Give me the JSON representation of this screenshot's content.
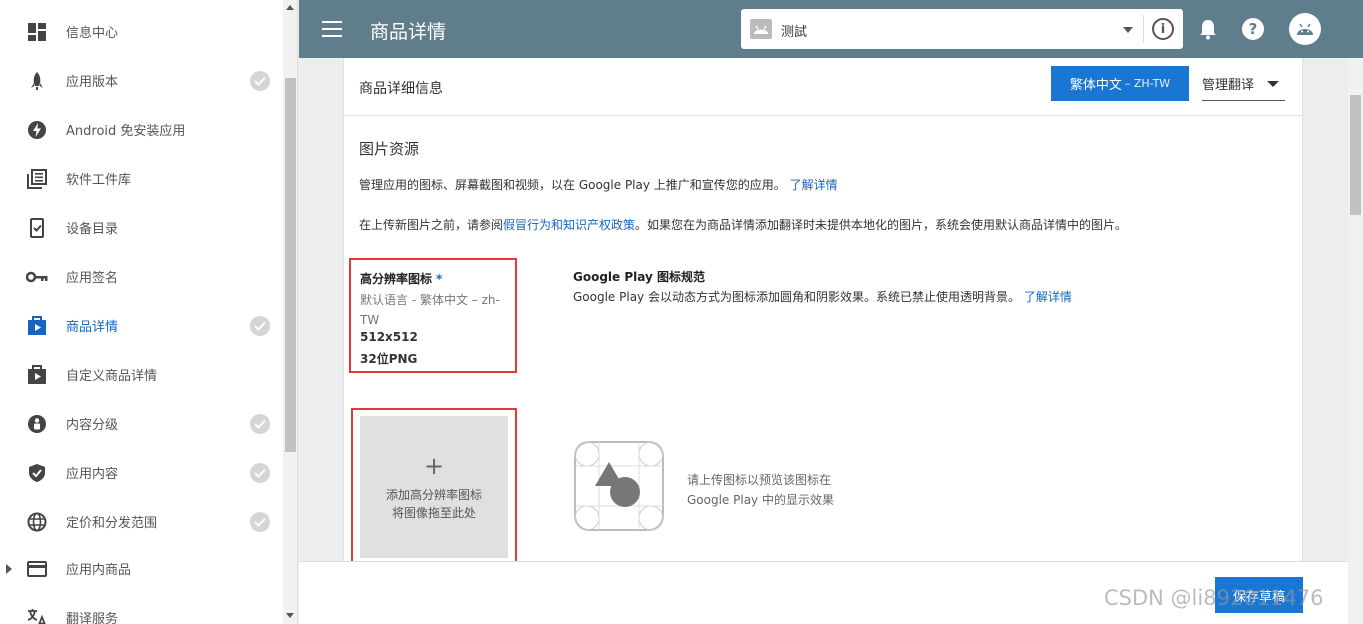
{
  "sidebar": {
    "items": [
      {
        "label": "信息中心",
        "icon": "dashboard-icon",
        "checked": false
      },
      {
        "label": "应用版本",
        "icon": "rocket-icon",
        "checked": true
      },
      {
        "label": "Android 免安装应用",
        "icon": "bolt-icon",
        "checked": false
      },
      {
        "label": "软件工件库",
        "icon": "library-icon",
        "checked": false
      },
      {
        "label": "设备目录",
        "icon": "device-catalog-icon",
        "checked": false
      },
      {
        "label": "应用签名",
        "icon": "key-icon",
        "checked": false
      },
      {
        "label": "商品详情",
        "icon": "store-listing-icon",
        "checked": true,
        "active": true
      },
      {
        "label": "自定义商品详情",
        "icon": "custom-listing-icon",
        "checked": false
      },
      {
        "label": "内容分级",
        "icon": "rating-icon",
        "checked": true
      },
      {
        "label": "应用内容",
        "icon": "shield-icon",
        "checked": true
      },
      {
        "label": "定价和分发范围",
        "icon": "globe-icon",
        "checked": true
      },
      {
        "label": "应用内商品",
        "icon": "card-icon",
        "checked": false,
        "expandable": true
      },
      {
        "label": "翻译服务",
        "icon": "translate-icon",
        "checked": false
      }
    ]
  },
  "topbar": {
    "title": "商品详情",
    "app_selector": {
      "value": "测試"
    }
  },
  "card": {
    "header_title": "商品详细信息",
    "lang_button": {
      "label": "繁体中文",
      "code": " – ZH-TW"
    },
    "manage_translate": "管理翻译",
    "section_title": "图片资源",
    "para1": {
      "text": "管理应用的图标、屏幕截图和视频，以在 Google Play 上推广和宣传您的应用。",
      "link": "了解详情"
    },
    "para2": {
      "before": "在上传新图片之前，请参阅",
      "link": "假冒行为和知识产权政策",
      "after": "。如果您在为商品详情添加翻译时未提供本地化的图片，系统会使用默认商品详情中的图片。"
    },
    "hires_icon": {
      "title": "高分辨率图标",
      "required_mark": "*",
      "language": "默认语言 - 繁体中文 – zh-TW",
      "size": "512x512",
      "format": "32位PNG"
    },
    "spec": {
      "title": "Google Play 图标规范",
      "desc": "Google Play 会以动态方式为图标添加圆角和阴影效果。系统已禁止使用透明背景。",
      "link": "了解详情"
    },
    "upload": {
      "plus": "+",
      "line1": "添加高分辨率图标",
      "line2": "将图像拖至此处"
    },
    "preview": {
      "line1": "请上传图标以预览该图标在",
      "line2": "Google Play 中的显示效果"
    }
  },
  "bottombar": {
    "save_label": "保存草稿",
    "watermark": "CSDN @li892011476"
  },
  "colors": {
    "topbar": "#607d8b",
    "accent": "#1976d2",
    "highlight": "#e53935"
  }
}
